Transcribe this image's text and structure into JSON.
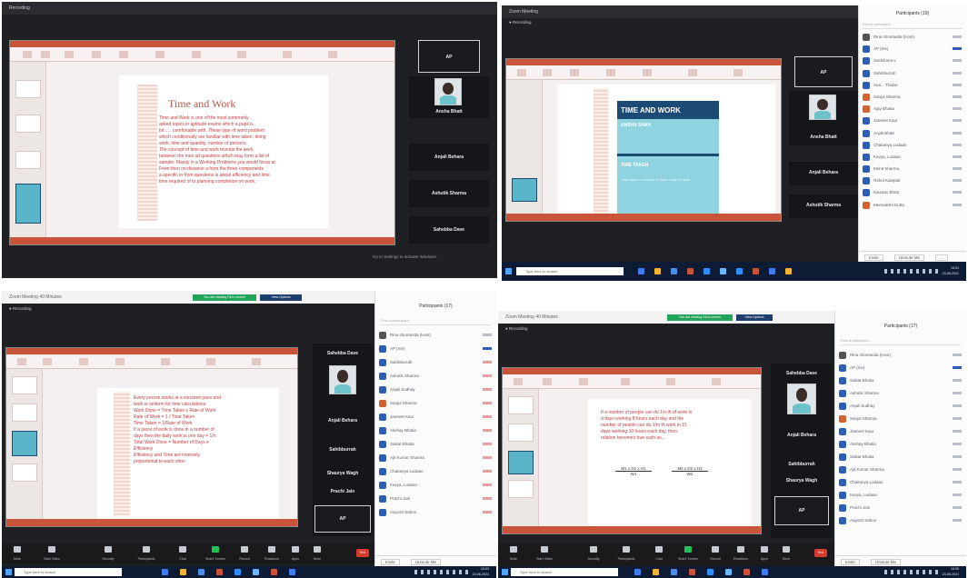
{
  "q1": {
    "window_title": "Recording",
    "slide": {
      "title": "Time and Work",
      "lines": [
        "Time and Work is one of the most commonly",
        "asked topics in aptitude exams which a pupil is",
        "bit ..... comfortable with. These type of word problem",
        "which conditionally are familiar with time taken, doing",
        "work, time and quantity, number of persons.",
        "The concept of time and work reveals the work",
        "between the man all questions which may form a list of",
        "sample. Mainly in a Working Problems you would focus at",
        "From then on distance a from the three components",
        "a specific in from questions is about efficiency and time",
        "time required of to planning completion on work."
      ]
    },
    "tiles": [
      "AP",
      "Ansha Bhatt",
      "Anjali Behara",
      "Ashutik Sharma",
      "Sahebba Dave"
    ],
    "footer_caption": "Go to Settings to activate Windows."
  },
  "q2": {
    "window_title": "Zoom Meeting",
    "recording": "Recording",
    "slide": {
      "title": "TIME AND WORK",
      "subtitle": "ANSHA SHAH",
      "section": "TIME TAKEN",
      "footnote": "Time taken = amount of work / rate of work"
    },
    "tiles": [
      "AP",
      "Ansha Bhatt",
      "Anjali Behara",
      "Ashutik Sharma"
    ],
    "participants": {
      "header": "Participants (19)",
      "search": "Find a participant",
      "names": [
        "Rina shomanda (Host)",
        "AP (me)",
        "Sashikana v",
        "Sahibburrah",
        "Ana... Thakur",
        "Sanjul Sharma",
        "Ajay Bhatia",
        "Jasneet Kaur",
        "Anjali Bhatt",
        "Chaitanya Ludaan",
        "Kavya, Ludaan",
        "Mohit Sharma",
        "Rahul Kalepati",
        "Kaustav Bhatt",
        "Meenakshi Dutta"
      ],
      "footer_buttons": [
        "Invite",
        "Unmute Me",
        "..."
      ]
    },
    "taskbar": {
      "search": "Type here to search",
      "time": "10:01",
      "date": "23-06-2021"
    }
  },
  "q3": {
    "window_title": "Zoom Meeting 40 Minutes",
    "share_badges": [
      "You are viewing Rin's screen",
      "View Options"
    ],
    "recording": "Recording",
    "slide_lines": [
      "Every person works at a constant pace and",
      "work is uniform for time calculations.",
      "Work Done = Time Taken x Rate of Work",
      "Rate of Work = 1 / Time Taken",
      "Time Taken = 1/Rate of Work",
      "If a piece of work is done in a number of",
      "days then the daily work is one day = 1/n",
      "Total Work Done = Number of Days x",
      "Efficiency",
      "Efficiency and Time are inversely",
      "proportional to each other"
    ],
    "tiles": [
      "Sahebba Dave",
      "Anjali Behara",
      "Sahibburrah",
      "Shaurya Wagh",
      "Prachi Jain",
      "AP"
    ],
    "participants": {
      "header": "Participants (17)",
      "search": "Find a participant",
      "names": [
        "Rina shomanda (Host)",
        "AP (me)",
        "Sahibburrah",
        "Ashutik Sharma",
        "Anjali Sudhay",
        "Sanjul Sharma",
        "Jasneet Kaur",
        "Akshay Bhatia",
        "Saikat Bhatia",
        "Ajit Kumar Sharma",
        "Chaitanya Ludaan",
        "Kavya, Ludaan",
        "Prachi Jain",
        "Aayush Sahoo"
      ],
      "footer_buttons": [
        "Invite",
        "Unmute Me"
      ]
    },
    "toolbar": [
      "Mute",
      "Start Video",
      "Security",
      "Participants",
      "Chat",
      "Share Screen",
      "Record",
      "Reactions",
      "Apps",
      "More",
      "End"
    ],
    "taskbar": {
      "search": "Type here to search",
      "time": "10:03",
      "date": "23-06-2021"
    }
  },
  "q4": {
    "window_title": "Zoom Meeting 40 Minutes",
    "share_badges": [
      "You are viewing Rin's screen",
      "View Options"
    ],
    "recording": "Recording",
    "slide_lines": [
      "If a number of people can do 1/n th of work in",
      "d days working 8 hours each day and the",
      "number of people can do 1/m th work in 15",
      "days working 10 hours each day, then",
      "relation becomes true such as..."
    ],
    "formula_left": [
      "M1 x D1 x H1",
      "W1"
    ],
    "formula_right": [
      "M2 x D2 x H2",
      "W2"
    ],
    "tiles": [
      "Sahebba Dave",
      "Anjali Behara",
      "Sahibburrah",
      "Shaurya Wagh",
      "AP"
    ],
    "participants": {
      "header": "Participants (17)",
      "search": "Find a participant",
      "names": [
        "Rina shomanda (Host)",
        "AP (me)",
        "Saikat Bhatia",
        "Ashutik Sharma",
        "Anjali Sudhay",
        "Sanjul Sharma",
        "Jasneet Kaur",
        "Akshay Bhatia",
        "Saikat Bhatia",
        "Ajit Kumar Sharma",
        "Chaitanya Ludaan",
        "Kavya, Ludaan",
        "Prachi Jain",
        "Aayush Sahoo"
      ],
      "footer_buttons": [
        "Invite",
        "Unmute Me"
      ]
    },
    "toolbar": [
      "Mute",
      "Start Video",
      "Security",
      "Participants",
      "Chat",
      "Share Screen",
      "Record",
      "Reactions",
      "Apps",
      "More",
      "End"
    ],
    "taskbar": {
      "search": "Type here to search",
      "time": "10:05",
      "date": "23-06-2021"
    }
  },
  "colors": {
    "zoom_dark": "#1f2023",
    "ppt_orange": "#c9543a",
    "slide_red": "#c23b3b",
    "navy": "#1b4a74",
    "teal": "#5bb5c8",
    "zoom_blue": "#2d5eb5",
    "zoom_green": "#22c05a",
    "end_red": "#d93a2e",
    "taskbar": "#0d1b35"
  },
  "icons": [
    "mic-icon",
    "video-icon",
    "shield-icon",
    "people-icon",
    "chat-icon",
    "share-icon",
    "record-icon",
    "reaction-icon",
    "apps-icon",
    "more-icon",
    "windows-start-icon",
    "search-icon"
  ]
}
